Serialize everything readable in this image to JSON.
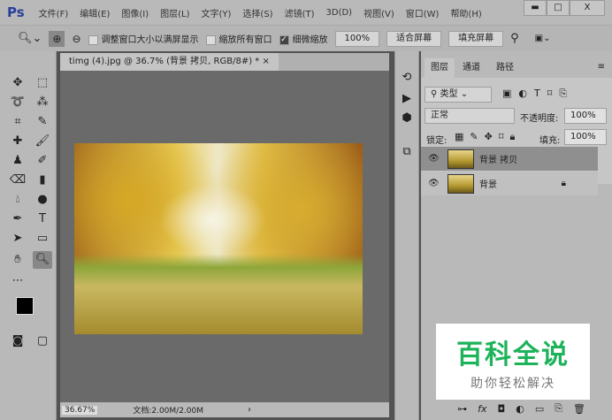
{
  "app": {
    "logo": "Ps"
  },
  "menu": [
    "文件(F)",
    "编辑(E)",
    "图像(I)",
    "图层(L)",
    "文字(Y)",
    "选择(S)",
    "滤镜(T)",
    "3D(D)",
    "视图(V)",
    "窗口(W)",
    "帮助(H)"
  ],
  "window": {
    "minimize": "▬",
    "maximize": "□",
    "close": "X"
  },
  "options": {
    "resize_windows": "调整窗口大小以满屏显示",
    "zoom_all": "缩放所有窗口",
    "scrubby_zoom": "细微缩放",
    "zoom_100": "100%",
    "fit_screen": "适合屏幕",
    "fill_screen": "填充屏幕"
  },
  "document": {
    "tab": "timg (4).jpg @ 36.7% (背景 拷贝, RGB/8#) *",
    "close": "×",
    "zoom": "36.67%",
    "doc_size": "文档:2.00M/2.00M",
    "arrow": "›"
  },
  "layers_panel": {
    "tabs": [
      "图层",
      "通道",
      "路径"
    ],
    "filter": "类型",
    "blend_mode": "正常",
    "opacity_label": "不透明度:",
    "opacity": "100%",
    "lock_label": "锁定:",
    "fill_label": "填充:",
    "fill": "100%",
    "layers": [
      {
        "name": "背景 拷贝",
        "selected": true,
        "locked": false
      },
      {
        "name": "背景",
        "selected": false,
        "locked": true
      }
    ]
  },
  "watermark": {
    "title": "百科全说",
    "subtitle": "助你轻松解决"
  }
}
